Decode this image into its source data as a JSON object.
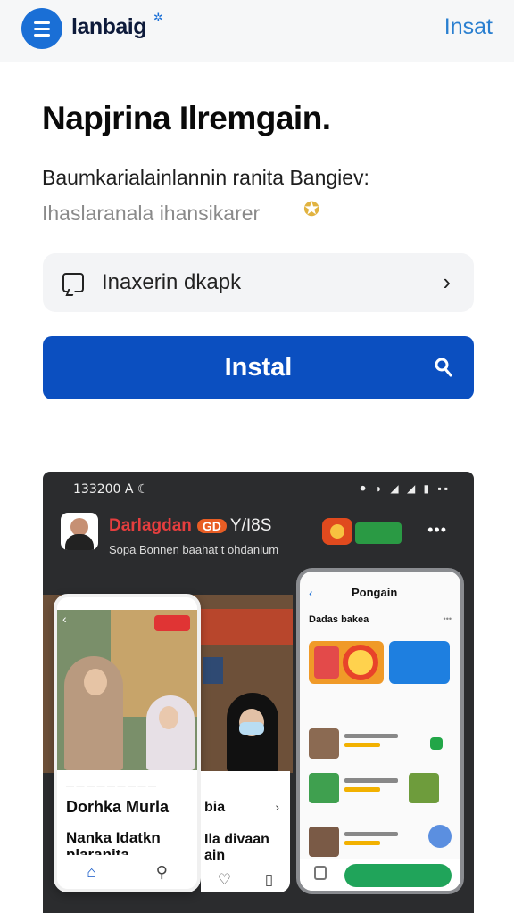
{
  "header": {
    "brand": "lanbaig",
    "action_label": "Insat"
  },
  "main": {
    "title": "Napjrina Ilremgain.",
    "subtitle": "Baumkarialainlannin ranita Bangiev:",
    "subtitle_secondary": "Ihaslaranala ihansikarer",
    "row_label": "Inaxerin dkapk",
    "install_label": "Instal"
  },
  "showcase": {
    "status_time": "133200 A ☾",
    "status_icons": "⚫ ◗ ◢ ◢ ▮ ▪▪",
    "feed_title": "Darlagdan",
    "feed_pill": "GD",
    "feed_title_tail": "Y/I8S",
    "feed_sub": "Sopa Bonnen baahat t ohdanium",
    "phone1": {
      "sub": "— — — — — — — — —",
      "name": "Dorhka Murla",
      "desc": "Nanka Idatkn plaranita"
    },
    "side_card": {
      "name": "bia",
      "desc": "Ila divaan ain"
    },
    "phone2": {
      "title": "Pongain",
      "section": "Dadas bakea"
    }
  },
  "colors": {
    "accent": "#1a6fd6",
    "install": "#0b4fc0",
    "header_bg": "#f6f7f8"
  }
}
